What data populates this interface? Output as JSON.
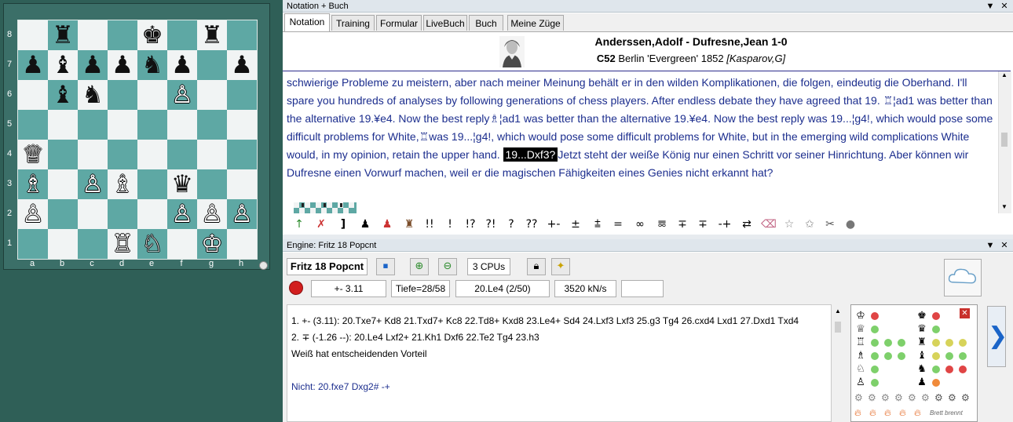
{
  "board": {
    "ranks": [
      "8",
      "7",
      "6",
      "5",
      "4",
      "3",
      "2",
      "1"
    ],
    "files": [
      "a",
      "b",
      "c",
      "d",
      "e",
      "f",
      "g",
      "h"
    ],
    "pieces": [
      {
        "sq": "b8",
        "glyph": "♜",
        "color": "b",
        "name": "black-rook"
      },
      {
        "sq": "e8",
        "glyph": "♚",
        "color": "b",
        "name": "black-king"
      },
      {
        "sq": "g8",
        "glyph": "♜",
        "color": "b",
        "name": "black-rook"
      },
      {
        "sq": "a7",
        "glyph": "♟",
        "color": "b",
        "name": "black-pawn"
      },
      {
        "sq": "b7",
        "glyph": "♝",
        "color": "b",
        "name": "black-bishop"
      },
      {
        "sq": "c7",
        "glyph": "♟",
        "color": "b",
        "name": "black-pawn"
      },
      {
        "sq": "d7",
        "glyph": "♟",
        "color": "b",
        "name": "black-pawn"
      },
      {
        "sq": "e7",
        "glyph": "♞",
        "color": "b",
        "name": "black-knight"
      },
      {
        "sq": "f7",
        "glyph": "♟",
        "color": "b",
        "name": "black-pawn"
      },
      {
        "sq": "h7",
        "glyph": "♟",
        "color": "b",
        "name": "black-pawn"
      },
      {
        "sq": "b6",
        "glyph": "♝",
        "color": "b",
        "name": "black-bishop"
      },
      {
        "sq": "c6",
        "glyph": "♞",
        "color": "b",
        "name": "black-knight"
      },
      {
        "sq": "f6",
        "glyph": "♙",
        "color": "w",
        "name": "white-pawn"
      },
      {
        "sq": "a4",
        "glyph": "♕",
        "color": "w",
        "name": "white-queen"
      },
      {
        "sq": "a3",
        "glyph": "♗",
        "color": "w",
        "name": "white-bishop"
      },
      {
        "sq": "c3",
        "glyph": "♙",
        "color": "w",
        "name": "white-pawn"
      },
      {
        "sq": "d3",
        "glyph": "♗",
        "color": "w",
        "name": "white-bishop"
      },
      {
        "sq": "f3",
        "glyph": "♛",
        "color": "b",
        "name": "black-queen"
      },
      {
        "sq": "a2",
        "glyph": "♙",
        "color": "w",
        "name": "white-pawn"
      },
      {
        "sq": "f2",
        "glyph": "♙",
        "color": "w",
        "name": "white-pawn"
      },
      {
        "sq": "g2",
        "glyph": "♙",
        "color": "w",
        "name": "white-pawn"
      },
      {
        "sq": "h2",
        "glyph": "♙",
        "color": "w",
        "name": "white-pawn"
      },
      {
        "sq": "d1",
        "glyph": "♖",
        "color": "w",
        "name": "white-rook"
      },
      {
        "sq": "e1",
        "glyph": "♘",
        "color": "w",
        "name": "white-knight"
      },
      {
        "sq": "g1",
        "glyph": "♔",
        "color": "w",
        "name": "white-king"
      }
    ]
  },
  "notation_panel": {
    "title": "Notation + Buch",
    "tabs": [
      "Notation",
      "Training",
      "Formular",
      "LiveBuch",
      "Buch",
      "Meine Züge"
    ],
    "active_tab": "Notation",
    "header": {
      "players": "Anderssen,Adolf - Dufresne,Jean  1-0",
      "eco": "C52",
      "event": "Berlin 'Evergreen' 1852",
      "annotator": "[Kasparov,G]"
    },
    "text_before": "schwierige Probleme zu meistern, aber nach meiner Meinung behält er in den wilden Komplikationen, die folgen, eindeutig die Oberhand. I'll spare you hundreds of analyses by following generations of chess players. After endless debate they have agreed that 19. ♖¦ad1 was better than the alternative 19.¥e4. Now the best reply♗¦ad1 was better than the alternative 19.¥e4. Now the best reply was 19...¦g4!, which would pose some difficult problems for White,♖was 19...¦g4!, which would pose some difficult problems for White, but in the emerging wild complications White would, in my opinion, retain the upper hand. ",
    "current_move": "19...Dxf3?",
    "text_after": "Jetzt steht der weiße König nur einen Schritt vor seiner Hinrichtung. Aber können wir Dufresne einen Vorwurf machen, weil er die magischen Fähigkeiten eines Genies nicht erkannt hat?",
    "annotation_symbols": [
      "!!",
      "!",
      "!?",
      "?!",
      "?",
      "??",
      "+-",
      "±",
      "⩲",
      "=",
      "∞",
      "⯹",
      "∓",
      "∓",
      "-+",
      "⇄"
    ]
  },
  "engine_panel": {
    "title": "Engine: Fritz 18 Popcnt",
    "engine_name": "Fritz 18 Popcnt",
    "cpus": "3 CPUs",
    "eval": "+- 3.11",
    "depth": "Tiefe=28/58",
    "current_move": "20.Le4 (2/50)",
    "speed": "3520 kN/s",
    "extra": "",
    "lines": [
      "1. +- (3.11): 20.Txe7+ Kd8 21.Txd7+ Kc8 22.Td8+ Kxd8 23.Le4+ Sd4 24.Lxf3 Lxf3 25.g3 Tg4 26.cxd4 Lxd1 27.Dxd1 Txd4",
      "2. ∓ (-1.26 --): 20.Le4 Lxf2+ 21.Kh1 Dxf6 22.Te2 Tg4 23.h3",
      "Weiß hat entscheidenden Vorteil",
      "",
      "Nicht: 20.fxe7 Dxg2#  -+"
    ],
    "brett_brennt": "Brett brennt",
    "colors": {
      "red": "#e04545",
      "green": "#7ed06b",
      "yellow": "#d7d35a",
      "orange": "#f08a3a"
    }
  }
}
